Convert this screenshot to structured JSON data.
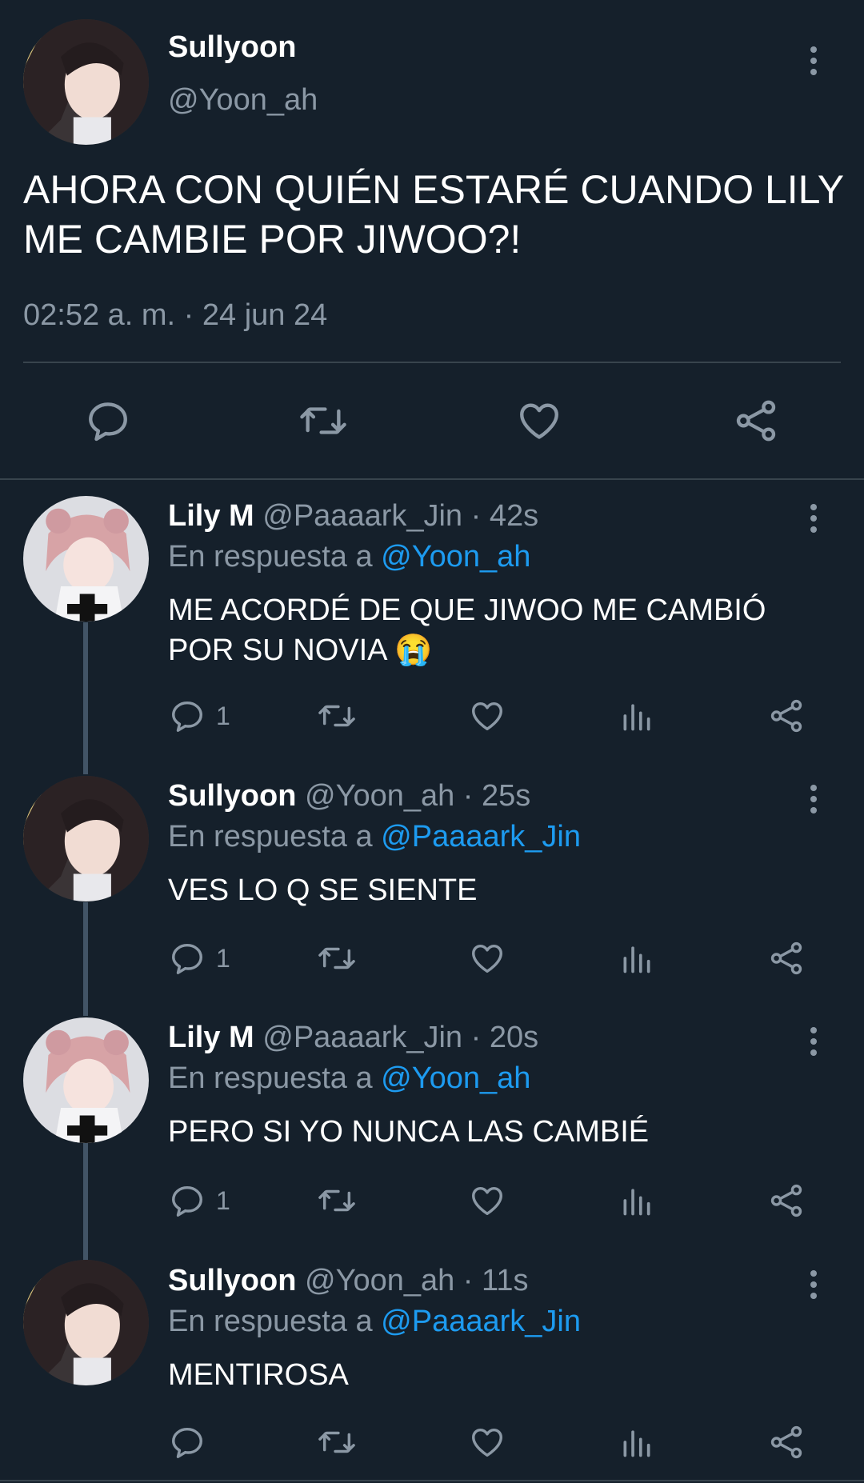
{
  "main_tweet": {
    "display_name": "Sullyoon",
    "handle": "@Yoon_ah",
    "text_line1": "AHORA CON QUIÉN ESTARÉ CUANDO LILY",
    "text_line2": "ME CAMBIE POR JIWOO?!",
    "timestamp": "02:52 a. m. · 24 jun 24"
  },
  "replies": [
    {
      "display_name": "Lily M",
      "handle_time": "@Paaaark_Jin · 42s",
      "in_reply_prefix": "En respuesta a",
      "in_reply_handle": "@Yoon_ah",
      "text_line1": "ME ACORDÉ DE QUE JIWOO ME CAMBIÓ",
      "text_line2": "POR SU NOVIA 😭",
      "reply_count": "1"
    },
    {
      "display_name": "Sullyoon",
      "handle_time": "@Yoon_ah · 25s",
      "in_reply_prefix": "En respuesta a",
      "in_reply_handle": "@Paaaark_Jin",
      "text_line1": "VES LO Q SE SIENTE",
      "reply_count": "1"
    },
    {
      "display_name": "Lily M",
      "handle_time": "@Paaaark_Jin · 20s",
      "in_reply_prefix": "En respuesta a",
      "in_reply_handle": "@Yoon_ah",
      "text_line1": "PERO SI YO NUNCA LAS CAMBIÉ",
      "reply_count": "1"
    },
    {
      "display_name": "Sullyoon",
      "handle_time": "@Yoon_ah · 11s",
      "in_reply_prefix": "En respuesta a",
      "in_reply_handle": "@Paaaark_Jin",
      "text_line1": "MENTIROSA",
      "reply_count": ""
    }
  ],
  "icons": {
    "reply": "reply-icon",
    "retweet": "retweet-icon",
    "like": "heart-icon",
    "views": "views-icon",
    "share": "share-icon",
    "more": "more-icon"
  },
  "colors": {
    "background": "#15202b",
    "text": "#ffffff",
    "muted": "#8b98a5",
    "link": "#1d9bf0",
    "divider": "#38444d",
    "thread_line": "#425466"
  }
}
